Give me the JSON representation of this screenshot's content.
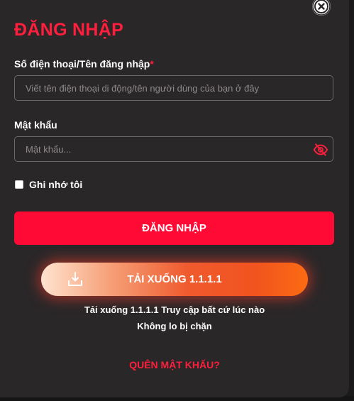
{
  "title": "ĐĂNG NHẬP",
  "username": {
    "label": "Số điện thoại/Tên đăng nhập",
    "required_mark": "*",
    "placeholder": "Viết tên điện thoại di động/tên người dùng của bạn ở đây",
    "value": ""
  },
  "password": {
    "label": "Mật khẩu",
    "placeholder": "Mật khẩu...",
    "value": "",
    "toggle_icon": "eye-off-icon"
  },
  "remember": {
    "label": "Ghi nhớ tôi",
    "checked": false
  },
  "login_button": "ĐĂNG NHẬP",
  "download": {
    "label": "TẢI XUỐNG 1.1.1.1",
    "icon": "download-icon",
    "line1": "Tải xuống 1.1.1.1 Truy cập bất cứ lúc nào",
    "line2": "Không lo bị chặn"
  },
  "forgot_password": "QUÊN MẬT KHẨU?",
  "colors": {
    "accent": "#ff1f3d",
    "button": "#ff0a35",
    "panel": "#2a2729"
  }
}
